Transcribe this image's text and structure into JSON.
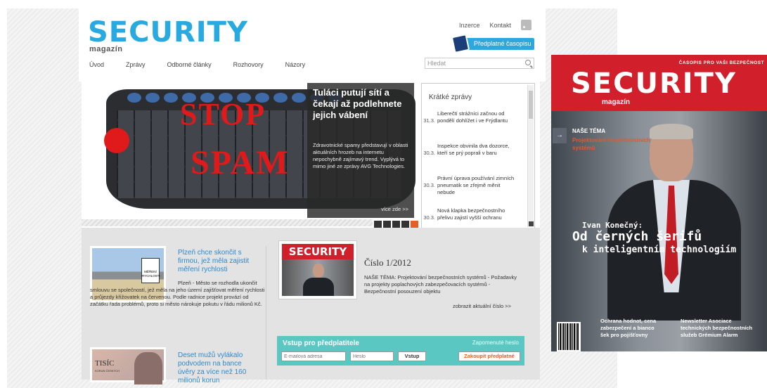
{
  "header": {
    "logo": "SECURITY",
    "logo_sub": "magazín",
    "links": [
      "Inzerce",
      "Kontakt"
    ],
    "subscribe": "Předplatné časopisu",
    "search_placeholder": "Hledat"
  },
  "nav": [
    "Úvod",
    "Zprávy",
    "Odborné články",
    "Rozhovory",
    "Názory"
  ],
  "slider": {
    "stop_text": "STOP",
    "spam_text": "SPAM",
    "title": "Tuláci putují sítí a čekají až podlehnete jejich vábení",
    "text": "Zdravotnické spamy představují v oblasti aktuálních hrozeb na internetu nepochybně zajímavý trend. Vyplývá to mimo jiné ze zprávy AVG Technologies.",
    "more": "více zde >>",
    "active_dot": 5
  },
  "short_news": {
    "title": "Krátké zprávy",
    "items": [
      {
        "date": "31.3.",
        "text": "Liberečtí strážníci začnou od pondělí dohlížet i ve Frýdlantu"
      },
      {
        "date": "30.3.",
        "text": "Inspekce obvinila dva dozorce, kteří se prý poprali v baru"
      },
      {
        "date": "30.3.",
        "text": "Právní úprava používání zimních pneumatik se zřejmě měnit nebude"
      },
      {
        "date": "30.3.",
        "text": "Nová klapka bezpečnostního přelivu zajistí vyšší ochranu"
      }
    ]
  },
  "articles": [
    {
      "title": "Plzeň chce skončit s firmou, jež měla zajistit měření rychlosti",
      "text": "Plzeň - Město se rozhodla ukončit smlouvu se společností, jež měla na jeho území zajišťovat měření rychlosti a průjezdy křižovatek na červenou. Podle radnice projekt provází od začátku řada problémů, proto si město nárokuje pokutu v řádu milionů Kč.",
      "sign_text": "MĚŘENÍ RYCHLOSTI"
    },
    {
      "title": "Deset mužů vylákalo podvodem na bance úvěry za více než 160 milionů korun",
      "banknote_text": "TISÍC",
      "banknote_sub": "KORUN ČESKÝCH"
    }
  ],
  "issue": {
    "logo": "SECURITY",
    "title": "Číslo 1/2012",
    "desc": "NAŠE TÉMA: Projektování bezpečnostních systémů - Požadavky na projekty poplachových zabezpečovacích systémů - Bezpečnostní posouzení objektu",
    "link": "zobrazit aktuální číslo >>"
  },
  "login": {
    "title": "Vstup pro předplatitele",
    "forgot": "Zapomenuté heslo",
    "email_placeholder": "E-mailová adresa",
    "password_placeholder": "Heslo",
    "submit": "Vstup",
    "buy": "Zakoupit předplatné"
  },
  "cover": {
    "tagline": "ČASOPIS PRO VAŠI BEZPEČNOST",
    "logo": "SECURITY",
    "logo_sub": "magazín",
    "theme_label": "NAŠE TÉMA",
    "theme": "Projektování bezpečnostních systémů",
    "name": "Ivan Konečný:",
    "headline": "Od černých šerifů",
    "headline2": "k inteligentním technologiím",
    "bottom_left": "Ochrana hodnot, cena zabezpečení a bianco šek pro pojišťovny",
    "bottom_right": "Newsletter Asociace technických bezpečnostních služeb Grémium Alarm"
  }
}
